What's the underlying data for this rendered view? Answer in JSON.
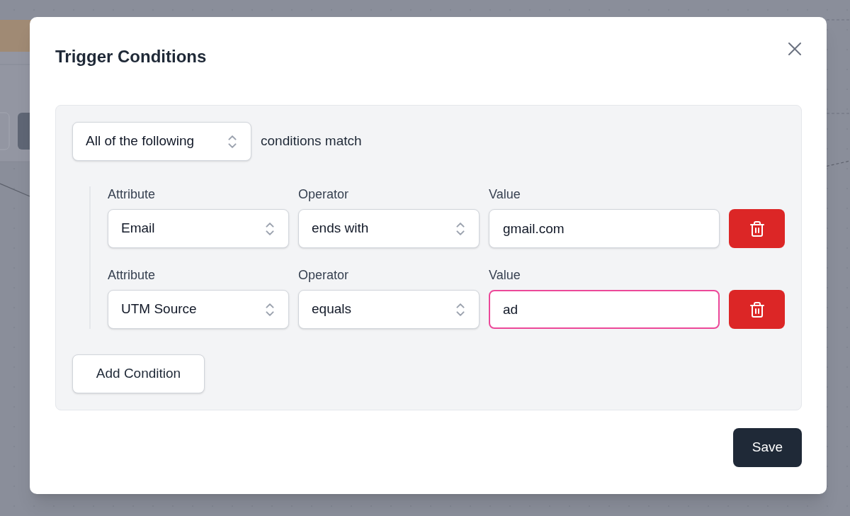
{
  "dialog": {
    "title": "Trigger Conditions"
  },
  "match": {
    "select_value": "All of the following",
    "suffix": "conditions match"
  },
  "conditions": [
    {
      "attribute_label": "Attribute",
      "attribute": "Email",
      "operator_label": "Operator",
      "operator": "ends with",
      "value_label": "Value",
      "value": "gmail.com",
      "focused": false
    },
    {
      "attribute_label": "Attribute",
      "attribute": "UTM Source",
      "operator_label": "Operator",
      "operator": "equals",
      "value_label": "Value",
      "value": "ad",
      "focused": true
    }
  ],
  "buttons": {
    "add": "Add Condition",
    "save": "Save"
  }
}
